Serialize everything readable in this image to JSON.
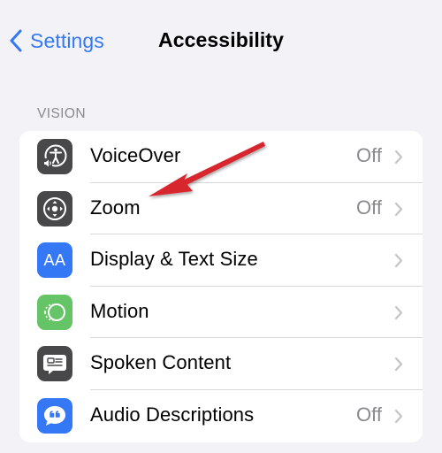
{
  "navbar": {
    "back_label": "Settings",
    "title": "Accessibility"
  },
  "section": {
    "header": "VISION",
    "items": [
      {
        "label": "VoiceOver",
        "value": "Off",
        "icon": "voiceover-icon",
        "icon_bg": "#48484a"
      },
      {
        "label": "Zoom",
        "value": "Off",
        "icon": "zoom-icon",
        "icon_bg": "#48484a"
      },
      {
        "label": "Display & Text Size",
        "value": "",
        "icon": "text-size-icon",
        "icon_bg": "#3478f6"
      },
      {
        "label": "Motion",
        "value": "",
        "icon": "motion-icon",
        "icon_bg": "#65c466"
      },
      {
        "label": "Spoken Content",
        "value": "",
        "icon": "spoken-content-icon",
        "icon_bg": "#48484a"
      },
      {
        "label": "Audio Descriptions",
        "value": "Off",
        "icon": "audio-descriptions-icon",
        "icon_bg": "#3478f6"
      }
    ]
  },
  "icons": {
    "text_size_glyph": "AA"
  },
  "colors": {
    "accent": "#3478f6",
    "background": "#f2f2f7",
    "annotation_arrow": "#d8262e"
  }
}
